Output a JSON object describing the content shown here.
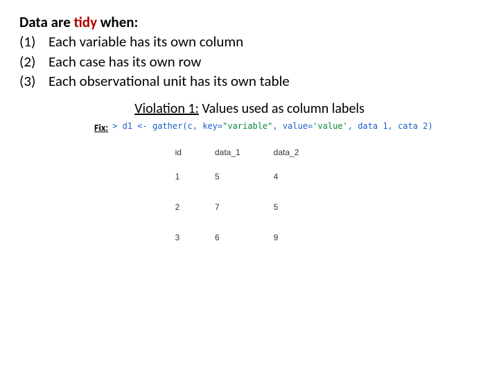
{
  "heading_prefix": "Data are ",
  "heading_tidy": "tidy",
  "heading_suffix": " when:",
  "items": [
    {
      "num": "(1)",
      "text": "Each variable has its own column"
    },
    {
      "num": "(2)",
      "text": "Each case has its own row"
    },
    {
      "num": "(3)",
      "text": "Each observational unit has its own table"
    }
  ],
  "violation": {
    "lead": "Violation 1:",
    "rest": " Values used as column labels"
  },
  "fix_label": "Fix:",
  "code": {
    "prompt": "> ",
    "p1": "d1 <- gather(c, key=",
    "s1": "\"variable\"",
    "p2": ", value=",
    "s2": "'value'",
    "p3": ", data 1, cata 2)"
  },
  "chart_data": {
    "type": "table",
    "columns": [
      "id",
      "data_1",
      "data_2"
    ],
    "rows": [
      [
        "1",
        "5",
        "4"
      ],
      [
        "2",
        "7",
        "5"
      ],
      [
        "3",
        "6",
        "9"
      ]
    ]
  }
}
